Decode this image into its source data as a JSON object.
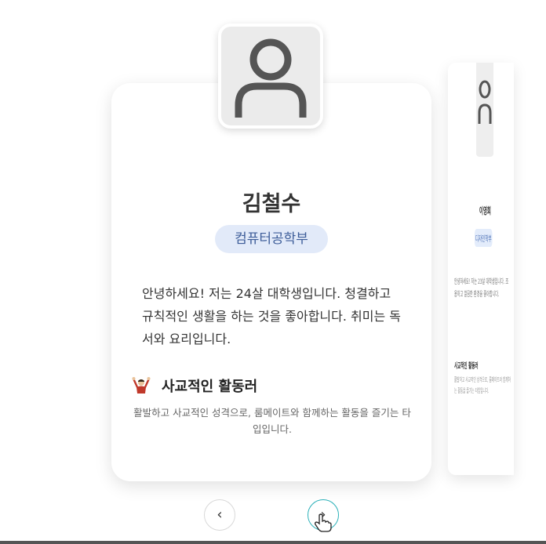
{
  "profile": {
    "name": "김철수",
    "department": "컴퓨터공학부",
    "bio": "안녕하세요! 저는 24살 대학생입니다. 청결하고 규칙적인 생활을 하는 것을 좋아합니다. 취미는 독서와 요리입니다.",
    "type_icon": "cheering-person-icon",
    "type_title": "사교적인 활동러",
    "type_description": "활발하고 사교적인 성격으로, 룸메이트와 함께하는 활동을 즐기는 타입입니다."
  },
  "next_profile": {
    "name": "이영희",
    "department": "디자인학부",
    "bio": "안녕하세요! 저는 23살 대학생입니다. 조용하고 깔끔한 환경을 좋아합니다.",
    "type_title": "사교적인 활동러",
    "type_description": "활발하고 사교적인 성격으로, 룸메이트와 함께하는 활동을 즐기는 타입입니다."
  },
  "nav": {
    "prev_label": "‹",
    "next_label": "›"
  }
}
